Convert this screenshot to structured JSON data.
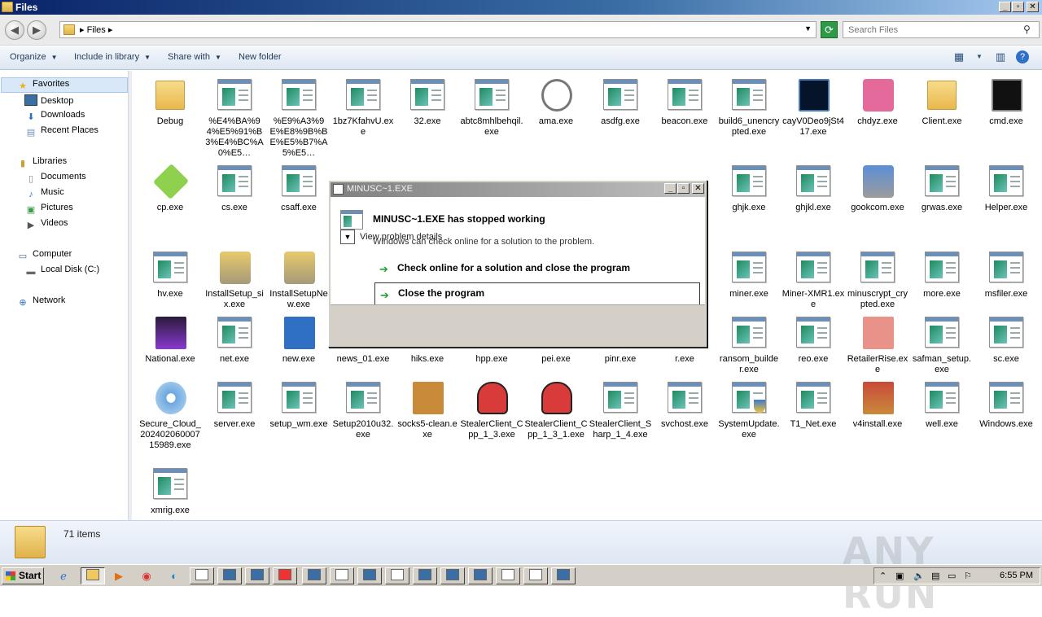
{
  "window": {
    "title": "Files"
  },
  "address": {
    "path": "Files",
    "search_placeholder": "Search Files"
  },
  "toolbar": {
    "organize": "Organize",
    "include_in_library": "Include in library",
    "share_with": "Share with",
    "new_folder": "New folder"
  },
  "nav": {
    "favorites": "Favorites",
    "desktop": "Desktop",
    "downloads": "Downloads",
    "recent_places": "Recent Places",
    "libraries": "Libraries",
    "documents": "Documents",
    "music": "Music",
    "pictures": "Pictures",
    "videos": "Videos",
    "computer": "Computer",
    "local_disk": "Local Disk (C:)",
    "network": "Network"
  },
  "files": [
    {
      "name": "Debug",
      "icon": "folder-icon"
    },
    {
      "name": "%E4%BA%94%E5%91%B3%E4%BC%A0%E5…",
      "icon": "exe-icon"
    },
    {
      "name": "%E9%A3%9E%E8%9B%BE%E5%B7%A5%E5…",
      "icon": "exe-icon"
    },
    {
      "name": "1bz7KfahvU.exe",
      "icon": "exe-icon"
    },
    {
      "name": "32.exe",
      "icon": "exe-icon"
    },
    {
      "name": "abtc8mhlbehqil.exe",
      "icon": "exe-icon"
    },
    {
      "name": "ama.exe",
      "icon": "gauge-icon"
    },
    {
      "name": "asdfg.exe",
      "icon": "exe-icon"
    },
    {
      "name": "beacon.exe",
      "icon": "exe-icon"
    },
    {
      "name": "build6_unencrypted.exe",
      "icon": "exe-icon"
    },
    {
      "name": "cayV0Deo9jSt417.exe",
      "icon": "monitor-icon"
    },
    {
      "name": "chdyz.exe",
      "icon": "shield-app-icon"
    },
    {
      "name": "Client.exe",
      "icon": "folder-icon"
    },
    {
      "name": "cmd.exe",
      "icon": "cmd-icon"
    },
    {
      "name": "cp.exe",
      "icon": "cube-icon"
    },
    {
      "name": "cs.exe",
      "icon": "exe-icon"
    },
    {
      "name": "csaff.exe",
      "icon": "exe-icon"
    },
    {
      "name": "ghjk.exe",
      "icon": "exe-icon"
    },
    {
      "name": "ghjkl.exe",
      "icon": "exe-icon"
    },
    {
      "name": "gookcom.exe",
      "icon": "installer-icon"
    },
    {
      "name": "grwas.exe",
      "icon": "exe-icon"
    },
    {
      "name": "Helper.exe",
      "icon": "exe-icon"
    },
    {
      "name": "hv.exe",
      "icon": "exe-icon"
    },
    {
      "name": "InstallSetup_six.exe",
      "icon": "lock-shield-icon"
    },
    {
      "name": "InstallSetupNew.exe",
      "icon": "lock-shield-icon"
    },
    {
      "name": "miner.exe",
      "icon": "exe-icon"
    },
    {
      "name": "Miner-XMR1.exe",
      "icon": "exe-icon"
    },
    {
      "name": "minuscrypt_crypted.exe",
      "icon": "exe-icon"
    },
    {
      "name": "more.exe",
      "icon": "exe-icon"
    },
    {
      "name": "msfiler.exe",
      "icon": "exe-icon"
    },
    {
      "name": "National.exe",
      "icon": "lotus-icon"
    },
    {
      "name": "net.exe",
      "icon": "exe-icon"
    },
    {
      "name": "new.exe",
      "icon": "blue-app-icon"
    },
    {
      "name": "news_01.exe",
      "icon": "exe-icon"
    },
    {
      "name": "hiks.exe",
      "icon": "exe-icon"
    },
    {
      "name": "hpp.exe",
      "icon": "exe-icon"
    },
    {
      "name": "pei.exe",
      "icon": "exe-icon"
    },
    {
      "name": "pinr.exe",
      "icon": "exe-icon"
    },
    {
      "name": "r.exe",
      "icon": "exe-icon"
    },
    {
      "name": "ransom_builder.exe",
      "icon": "exe-icon"
    },
    {
      "name": "reo.exe",
      "icon": "exe-icon"
    },
    {
      "name": "RetailerRise.exe",
      "icon": "pink-app-icon"
    },
    {
      "name": "safman_setup.exe",
      "icon": "exe-icon"
    },
    {
      "name": "sc.exe",
      "icon": "exe-icon"
    },
    {
      "name": "Secure_Cloud_20240206000715989.exe",
      "icon": "disc-icon"
    },
    {
      "name": "server.exe",
      "icon": "exe-icon"
    },
    {
      "name": "setup_wm.exe",
      "icon": "exe-icon"
    },
    {
      "name": "Setup2010u32.exe",
      "icon": "exe-icon"
    },
    {
      "name": "socks5-clean.exe",
      "icon": "box-icon"
    },
    {
      "name": "StealerClient_Cpp_1_3.exe",
      "icon": "mitten-icon"
    },
    {
      "name": "StealerClient_Cpp_1_3_1.exe",
      "icon": "mitten-icon"
    },
    {
      "name": "StealerClient_Sharp_1_4.exe",
      "icon": "exe-icon"
    },
    {
      "name": "svchost.exe",
      "icon": "exe-icon"
    },
    {
      "name": "SystemUpdate.exe",
      "icon": "exe-shield-icon"
    },
    {
      "name": "T1_Net.exe",
      "icon": "exe-icon"
    },
    {
      "name": "v4install.exe",
      "icon": "box-shield-icon"
    },
    {
      "name": "well.exe",
      "icon": "exe-icon"
    },
    {
      "name": "Windows.exe",
      "icon": "exe-icon"
    },
    {
      "name": "xmrig.exe",
      "icon": "exe-icon"
    }
  ],
  "status": {
    "item_count": "71 items",
    "watermark": "ANY RUN"
  },
  "dialog": {
    "title": "MINUSC~1.EXE",
    "heading": "MINUSC~1.EXE has stopped working",
    "subtext": "Windows can check online for a solution to the problem.",
    "option_check": "Check online for a solution and close the program",
    "option_close": "Close the program",
    "details": "View problem details"
  },
  "taskbar": {
    "start": "Start",
    "clock": "6:55 PM"
  },
  "colors": {
    "titlebar": "#0a246a",
    "toolbar_text": "#1e395b",
    "green_arrow": "#2a9d2a"
  }
}
